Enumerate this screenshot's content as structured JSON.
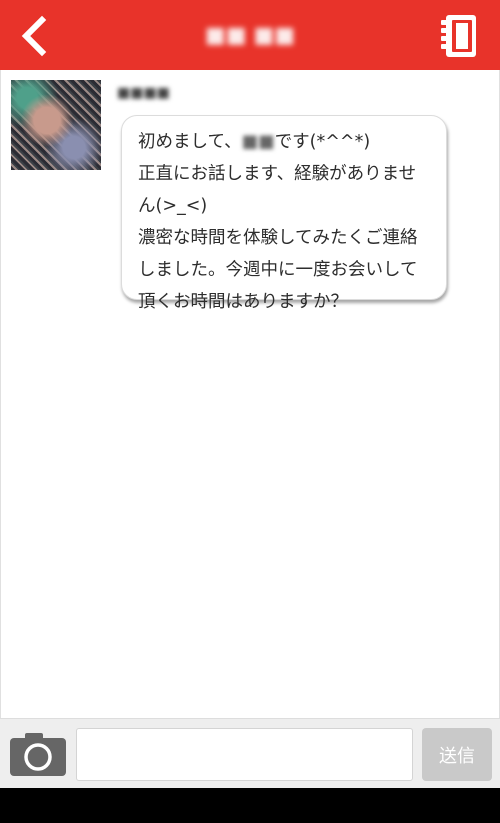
{
  "header": {
    "title": "■■ ■■",
    "back_icon": "chevron-left-icon",
    "notebook_icon": "notebook-icon",
    "background": "#e8332a"
  },
  "message": {
    "sender_name": "■■■■",
    "lines": [
      "初めまして、",
      "です(*^^*)",
      "正直にお話します、経験がありません(>_<)",
      "濃密な時間を体験してみたくご連絡しました。今週中に一度お会いして頂くお時間はありますか？"
    ],
    "redacted_name": "■■"
  },
  "input_bar": {
    "camera_icon": "camera-icon",
    "input_value": "",
    "input_placeholder": "",
    "send_label": "送信"
  }
}
